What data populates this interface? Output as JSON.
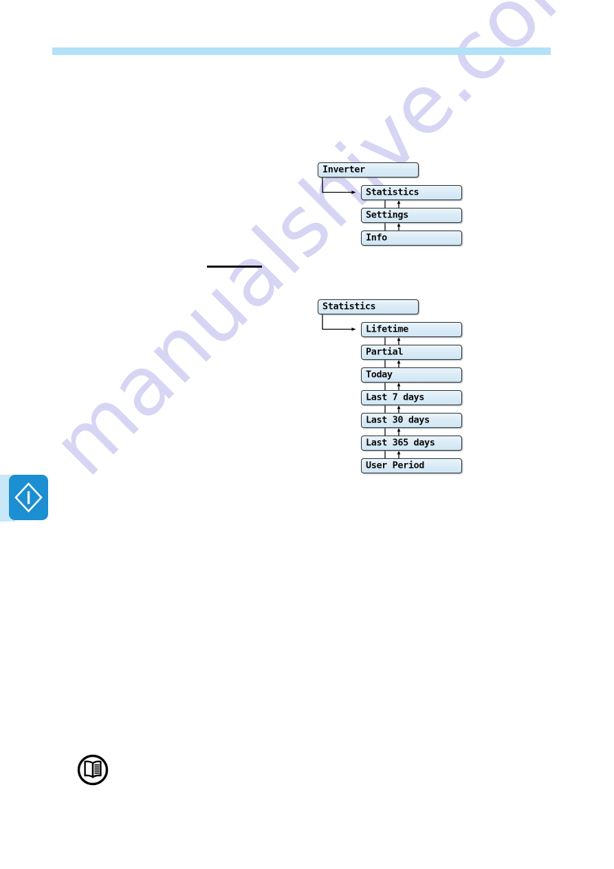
{
  "page": {
    "background_color": "#ffffff",
    "header_rule_color": "#b3e1f7",
    "watermark_text": "manualshive.com",
    "watermark_color": "#c9c6f0"
  },
  "side_tab": {
    "icon": "warning-diamond-icon",
    "color": "#1b8fd1",
    "backing_color": "#c8e7f7"
  },
  "note_icon": {
    "icon": "open-book-icon",
    "color": "#000000"
  },
  "redaction": {
    "rule": "underline-rule"
  },
  "diagrams": [
    {
      "id": "inverter-menu",
      "root": {
        "label": "Inverter"
      },
      "items": [
        {
          "label": "Statistics"
        },
        {
          "label": "Settings"
        },
        {
          "label": "Info"
        }
      ]
    },
    {
      "id": "statistics-menu",
      "root": {
        "label": "Statistics"
      },
      "items": [
        {
          "label": "Lifetime"
        },
        {
          "label": "Partial"
        },
        {
          "label": "Today"
        },
        {
          "label": "Last 7 days"
        },
        {
          "label": "Last 30 days"
        },
        {
          "label": "Last 365 days"
        },
        {
          "label": "User Period"
        }
      ]
    }
  ]
}
